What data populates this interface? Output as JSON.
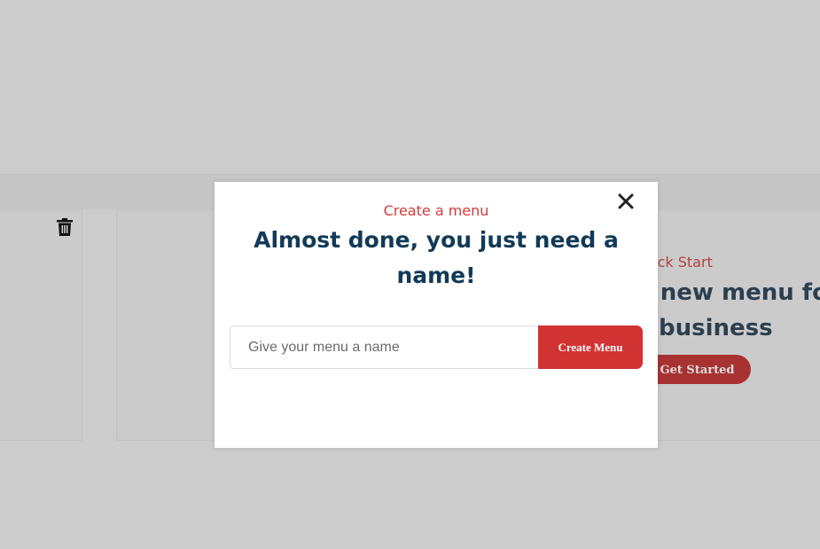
{
  "background": {
    "quick_start": "uick Start",
    "heading_line1": "Create a new menu for",
    "heading_line2": "business",
    "get_started": "Get Started"
  },
  "modal": {
    "subtitle": "Create a menu",
    "title": "Almost done, you just need a name!",
    "input_value": "",
    "input_placeholder": "Give your menu a name",
    "create_button": "Create Menu",
    "close_icon": "close-icon"
  },
  "icons": {
    "trash": "trash-icon",
    "close": "close-icon"
  },
  "colors": {
    "accent_red": "#d13333",
    "title_navy": "#123a57",
    "subtitle_red": "#d13a3a",
    "page_bg": "#cccccc"
  }
}
